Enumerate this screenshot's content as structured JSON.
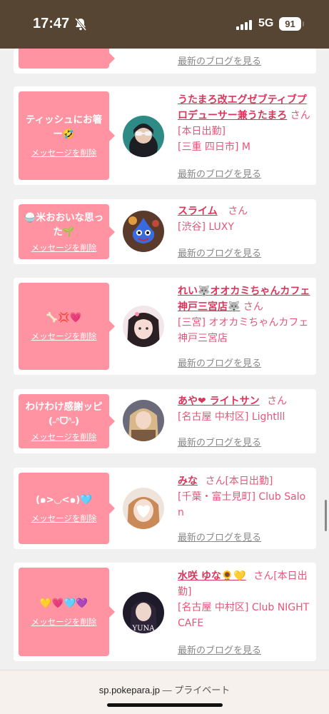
{
  "status_bar": {
    "time": "17:47",
    "network": "5G",
    "battery": "91"
  },
  "cards": [
    {
      "message": "",
      "delete_label": "",
      "name": "",
      "suffix": "",
      "location": "",
      "blog_label": "最新のブログを見る"
    },
    {
      "message": "ティッシュにお箸ー🤣",
      "delete_label": "メッセージを削除",
      "name": "うたまろ改エグゼブティブプロデューサー兼うたまろ",
      "suffix": "さん[本日出勤]",
      "location": "[三重 四日市] M",
      "blog_label": "最新のブログを見る"
    },
    {
      "message": "🍚米おおいな思った🌱",
      "delete_label": "メッセージを削除",
      "name": "スライム",
      "suffix": "さん",
      "location": "[渋谷] LUXY",
      "blog_label": "最新のブログを見る"
    },
    {
      "message": "🦴💢💗",
      "delete_label": "メッセージを削除",
      "name": "れい🐺オオカミちゃんカフェ神戸三宮店🐺",
      "suffix": "さん",
      "location": "[三宮] オオカミちゃんカフェ神戸三宮店",
      "blog_label": "最新のブログを見る"
    },
    {
      "message": "わけわけ感謝ッピ(˶ᐢᗜᐢ˶)",
      "delete_label": "メッセージを削除",
      "name": "あや❤ ライトサン",
      "suffix": "さん",
      "location": "[名古屋 中村区] Lightlll",
      "blog_label": "最新のブログを見る"
    },
    {
      "message": "(๑>◡<๑)🩵",
      "delete_label": "メッセージを削除",
      "name": "みな",
      "suffix": "さん[本日出勤]",
      "location": "[千葉・富士見町] Club Salon",
      "blog_label": "最新のブログを見る"
    },
    {
      "message": "💛💗🩵💜",
      "delete_label": "メッセージを削除",
      "name": "水咲 ゆな🌻💛",
      "suffix": "さん[本日出勤]",
      "location": "[名古屋 中村区] Club NIGHT CAFE",
      "blog_label": "最新のブログを見る"
    }
  ],
  "browser": {
    "url": "sp.pokepara.jp",
    "mode": "— プライベート"
  }
}
